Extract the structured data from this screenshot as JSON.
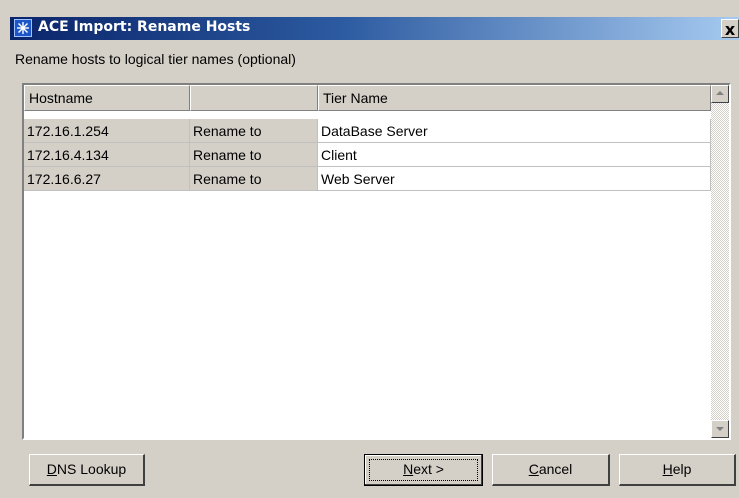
{
  "window": {
    "title": "ACE Import: Rename Hosts",
    "close_label": "x"
  },
  "instruction": "Rename hosts to logical tier names (optional)",
  "table": {
    "columns": [
      "Hostname",
      "",
      "Tier Name"
    ],
    "rows": [
      {
        "hostname": "172.16.1.254",
        "action": "Rename to",
        "tier": "DataBase Server"
      },
      {
        "hostname": "172.16.4.134",
        "action": "Rename to",
        "tier": "Client"
      },
      {
        "hostname": "172.16.6.27",
        "action": "Rename to",
        "tier": "Web Server"
      }
    ]
  },
  "buttons": {
    "dns_lookup": {
      "mnemonic": "D",
      "rest": "NS Lookup"
    },
    "next": {
      "mnemonic": "N",
      "rest": "ext >"
    },
    "cancel": {
      "mnemonic": "C",
      "rest": "ancel"
    },
    "help": {
      "mnemonic": "H",
      "rest": "elp"
    }
  },
  "icons": {
    "app": "ace-star-icon",
    "scroll_up": "scroll-up-arrow-icon",
    "scroll_down": "scroll-down-arrow-icon"
  },
  "colors": {
    "title_gradient_start": "#0a246a",
    "title_gradient_end": "#a6caf0",
    "face": "#d4d0c8"
  }
}
